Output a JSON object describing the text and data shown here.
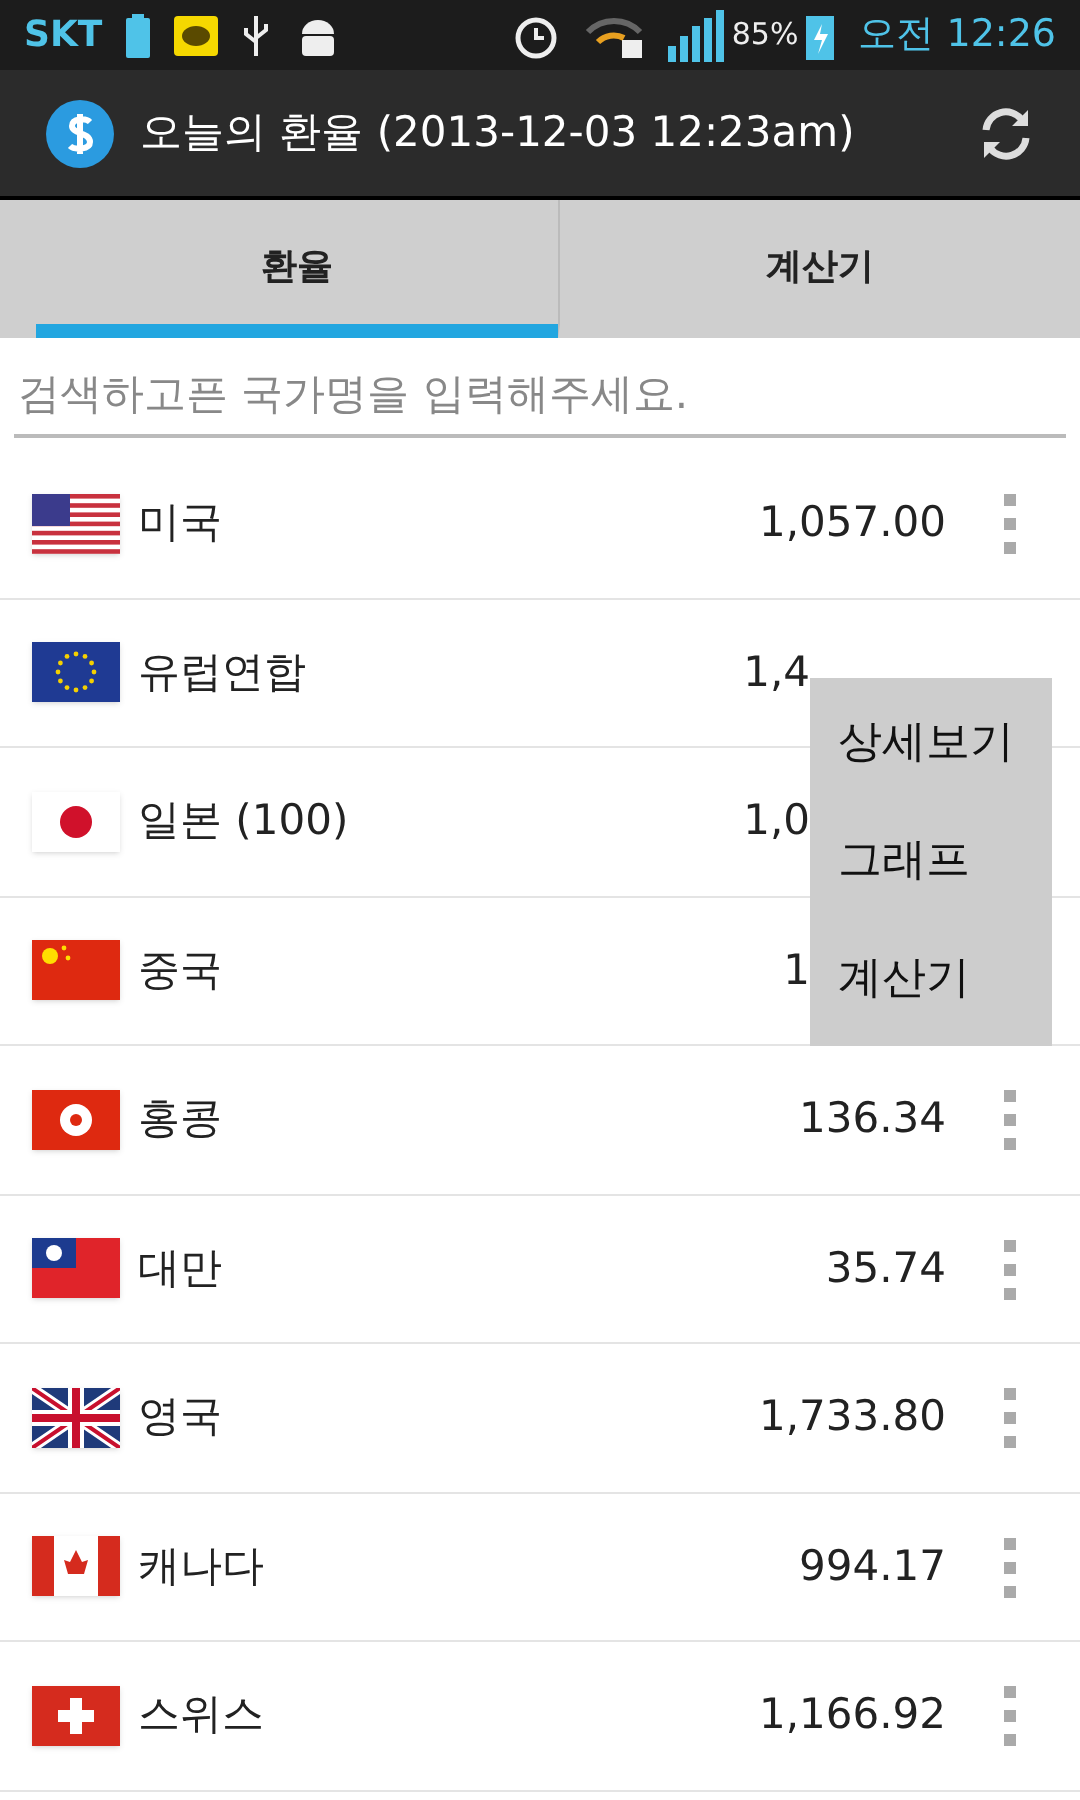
{
  "status_bar": {
    "carrier": "SKT",
    "battery": "85%",
    "time": "오전 12:26"
  },
  "action_bar": {
    "title": "오늘의 환율 (2013-12-03 12:23am)"
  },
  "tabs": [
    {
      "label": "환율",
      "selected": true
    },
    {
      "label": "계산기",
      "selected": false
    }
  ],
  "search": {
    "placeholder": "검색하고픈 국가명을 입력해주세요."
  },
  "rows": [
    {
      "kind": "us",
      "name": "미국",
      "value": "1,057.00",
      "menu_open": false
    },
    {
      "kind": "eu",
      "name": "유럽연합",
      "value": "1,4",
      "menu_open": true
    },
    {
      "kind": "jp",
      "name": "일본 (100)",
      "value": "1,0",
      "menu_open": false
    },
    {
      "kind": "cn",
      "name": "중국",
      "value": "1",
      "menu_open": false
    },
    {
      "kind": "hk",
      "name": "홍콩",
      "value": "136.34",
      "menu_open": false
    },
    {
      "kind": "tw",
      "name": "대만",
      "value": "35.74",
      "menu_open": false
    },
    {
      "kind": "gb",
      "name": "영국",
      "value": "1,733.80",
      "menu_open": false
    },
    {
      "kind": "ca",
      "name": "캐나다",
      "value": "994.17",
      "menu_open": false
    },
    {
      "kind": "ch",
      "name": "스위스",
      "value": "1,166.92",
      "menu_open": false
    }
  ],
  "menu": {
    "items": [
      "상세보기",
      "그래프",
      "계산기"
    ]
  }
}
